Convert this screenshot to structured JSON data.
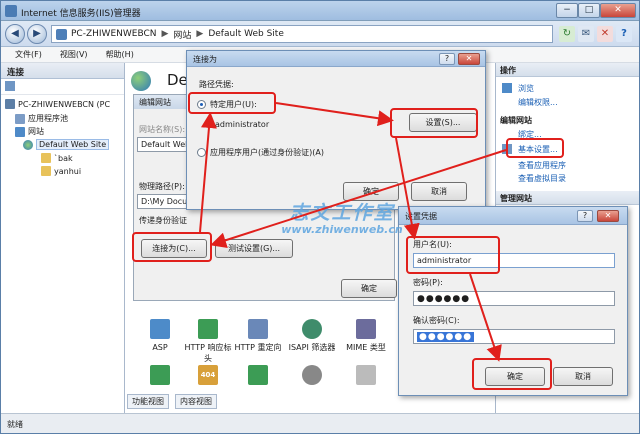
{
  "window": {
    "title": "Internet 信息服务(IIS)管理器",
    "min": "−",
    "max": "□",
    "close": "✕"
  },
  "address": {
    "back": "◀",
    "forward": "▶",
    "crumbs": [
      "PC-ZHIWENWEBCN",
      "网站",
      "Default Web Site"
    ],
    "separator": "▶"
  },
  "toolbar_icons": [
    "↻",
    "✉",
    "✕",
    "?"
  ],
  "menu": [
    "文件(F)",
    "视图(V)",
    "帮助(H)"
  ],
  "left_pane": {
    "title": "连接",
    "tree": [
      "PC-ZHIWENWEBCN (PC",
      "应用程序池",
      "网站",
      "Default Web Site",
      "`bak",
      "yanhui"
    ]
  },
  "center": {
    "site_title": "De",
    "edit_dialog": {
      "title": "编辑网站",
      "site_name_label": "网站名称(S):",
      "site_name_value": "Default Web",
      "physical_path_label": "物理路径(P):",
      "physical_path_value": "D:\\My Docu",
      "pass_auth_label": "传递身份验证",
      "connect_as_button": "连接为(C)...",
      "test_settings_button": "测试设置(G)...",
      "ok_button": "确定"
    },
    "features_row1": [
      {
        "label": "ASP",
        "color": "#4d8bc9"
      },
      {
        "label": "HTTP 响应标头",
        "color": "#3c9c55"
      },
      {
        "label": "HTTP 重定向",
        "color": "#6a88b8"
      },
      {
        "label": "ISAPI 筛选器",
        "color": "#3f8c6b"
      },
      {
        "label": "MIME 类型",
        "color": "#6c6c9c"
      }
    ],
    "features_row2": [
      {
        "label": "",
        "color": "#3c9c55"
      },
      {
        "label": "404",
        "color": "#d8a03a"
      },
      {
        "label": "",
        "color": "#3c9c55"
      },
      {
        "label": "",
        "color": "#888888"
      },
      {
        "label": "",
        "color": "#bbbbbb"
      }
    ],
    "bottom_tabs": [
      "功能视图",
      "内容视图"
    ]
  },
  "right_pane": {
    "actions_title": "操作",
    "links1": [
      "浏览",
      "编辑权限..."
    ],
    "edit_site_title": "编辑网站",
    "links2": [
      "绑定...",
      "基本设置...",
      "查看应用程序",
      "查看虚拟目录"
    ],
    "manage_title": "管理网站"
  },
  "connect_dialog": {
    "title": "连接为",
    "help": "?",
    "close": "✕",
    "path_credentials": "路径凭据:",
    "specific_user": "特定用户(U):",
    "user_value": "administrator",
    "set_button": "设置(S)...",
    "app_user": "应用程序用户(通过身份验证)(A)",
    "ok": "确定",
    "cancel": "取消"
  },
  "cred_dialog": {
    "title": "设置凭据",
    "help": "?",
    "close": "✕",
    "username_label": "用户名(U):",
    "username_value": "administrator",
    "password_label": "密码(P):",
    "password_value": "●●●●●●",
    "confirm_label": "确认密码(C):",
    "confirm_value": "●●●●●●",
    "ok": "确定",
    "cancel": "取消"
  },
  "status": "就绪",
  "watermark": {
    "big": "志文工作室",
    "small": "www.zhiwenweb.cn"
  },
  "colors": {
    "annotation": "#e0201c",
    "link": "#1a5fb4",
    "selection": "#3875d7"
  }
}
